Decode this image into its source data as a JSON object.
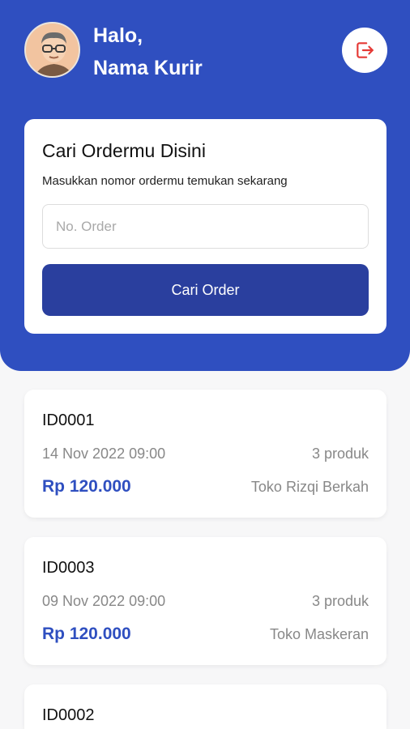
{
  "header": {
    "greeting_line1": "Halo,",
    "greeting_line2": "Nama Kurir",
    "avatar_icon": "courier-avatar",
    "logout_icon": "logout-icon",
    "accent_color": "#2f4fc0",
    "logout_color": "#e53935"
  },
  "search": {
    "title": "Cari Ordermu Disini",
    "subtitle": "Masukkan nomor ordermu temukan sekarang",
    "placeholder": "No. Order",
    "value": "",
    "button_label": "Cari Order",
    "button_color": "#2a3f9e"
  },
  "orders": [
    {
      "id": "ID0001",
      "date": "14 Nov 2022 09:00",
      "quantity": "3 produk",
      "price": "Rp 120.000",
      "store": "Toko Rizqi Berkah"
    },
    {
      "id": "ID0003",
      "date": "09 Nov 2022 09:00",
      "quantity": "3 produk",
      "price": "Rp 120.000",
      "store": "Toko Maskeran"
    },
    {
      "id": "ID0002"
    }
  ]
}
